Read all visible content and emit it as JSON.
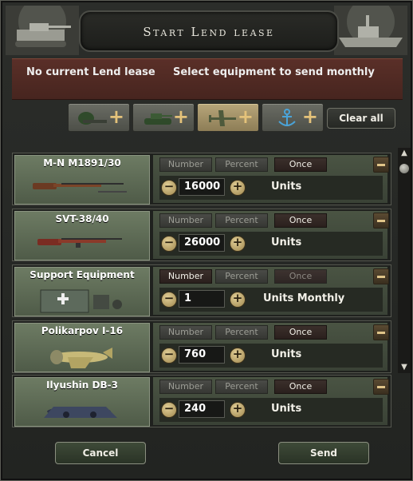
{
  "window": {
    "title": "Start Lend lease",
    "status_text": "No current Lend lease",
    "instruction_text": "Select equipment to send monthly"
  },
  "categories": [
    {
      "name": "infantry",
      "icon": "soldier-gun-icon",
      "active": false
    },
    {
      "name": "armor",
      "icon": "tank-icon",
      "active": false
    },
    {
      "name": "air",
      "icon": "airplane-icon",
      "active": true
    },
    {
      "name": "naval",
      "icon": "anchor-icon",
      "active": false
    }
  ],
  "clear_label": "Clear all",
  "modes": {
    "number": "Number",
    "percent": "Percent",
    "once": "Once"
  },
  "items": [
    {
      "name": "M-N M1891/30",
      "icon": "rifle-icon",
      "selected_mode": "once",
      "quantity": "16000",
      "unit": "Units"
    },
    {
      "name": "SVT-38/40",
      "icon": "semi-auto-rifle-icon",
      "selected_mode": "once",
      "quantity": "26000",
      "unit": "Units"
    },
    {
      "name": "Support Equipment",
      "icon": "support-equipment-icon",
      "selected_mode": "number",
      "quantity": "1",
      "unit": "Units Monthly"
    },
    {
      "name": "Polikarpov I-16",
      "icon": "fighter-plane-icon",
      "selected_mode": "once",
      "quantity": "760",
      "unit": "Units"
    },
    {
      "name": "Ilyushin DB-3",
      "icon": "bomber-plane-icon",
      "selected_mode": "once",
      "quantity": "240",
      "unit": "Units"
    }
  ],
  "buttons": {
    "cancel": "Cancel",
    "send": "Send"
  },
  "colors": {
    "accent_gold": "#e4c27a",
    "info_bar": "#5a2f28",
    "row_panel": "#4a5443"
  }
}
